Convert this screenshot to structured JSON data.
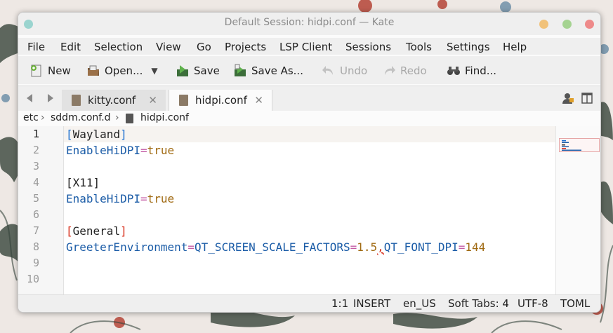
{
  "window": {
    "title": "Default Session: hidpi.conf — Kate",
    "colors": {
      "minimize": "#f1c27a",
      "maximize": "#a5d391",
      "close": "#ee8a8a",
      "left_dot": "#9ad4cf"
    }
  },
  "menubar": {
    "items": [
      "File",
      "Edit",
      "Selection",
      "View",
      "Go",
      "Projects",
      "LSP Client",
      "Sessions",
      "Tools",
      "Settings",
      "Help"
    ]
  },
  "toolbar": {
    "new_label": "New",
    "open_label": "Open...",
    "save_label": "Save",
    "save_as_label": "Save As...",
    "undo_label": "Undo",
    "redo_label": "Redo",
    "find_label": "Find..."
  },
  "tabs": [
    {
      "label": "kitty.conf",
      "active": false
    },
    {
      "label": "hidpi.conf",
      "active": true
    }
  ],
  "breadcrumb": {
    "items": [
      "etc",
      "sddm.conf.d",
      "hidpi.conf"
    ]
  },
  "editor": {
    "current_line": 1,
    "line_numbers": [
      "1",
      "2",
      "3",
      "4",
      "5",
      "6",
      "7",
      "8",
      "9",
      "10"
    ],
    "lines": {
      "l1": {
        "open": "[",
        "name": "Wayland",
        "close": "]"
      },
      "l2": {
        "key": "EnableHiDPI",
        "op": "=",
        "val": "true"
      },
      "l4": {
        "text": "[X11]"
      },
      "l5": {
        "key": "EnableHiDPI",
        "op": "=",
        "val": "true"
      },
      "l7": {
        "open": "[",
        "name": "General",
        "close": "]"
      },
      "l8": {
        "key": "GreeterEnvironment",
        "op1": "=",
        "key2": "QT_SCREEN_SCALE_FACTORS",
        "op2": "=",
        "val1": "1.5",
        "comma": ",",
        "key3": "QT_FONT_DPI",
        "op3": "=",
        "val2": "144"
      }
    },
    "syntax_colors": {
      "section_bracket_ok": "#1b6fd1",
      "section_bracket_error": "#d8301c",
      "key": "#1b5ca7",
      "operator": "#c45ba4",
      "value": "#a06a12"
    }
  },
  "statusbar": {
    "position": "1:1",
    "mode": "INSERT",
    "dictionary": "en_US",
    "indent": "Soft Tabs: 4",
    "encoding": "UTF-8",
    "syntax": "TOML"
  }
}
